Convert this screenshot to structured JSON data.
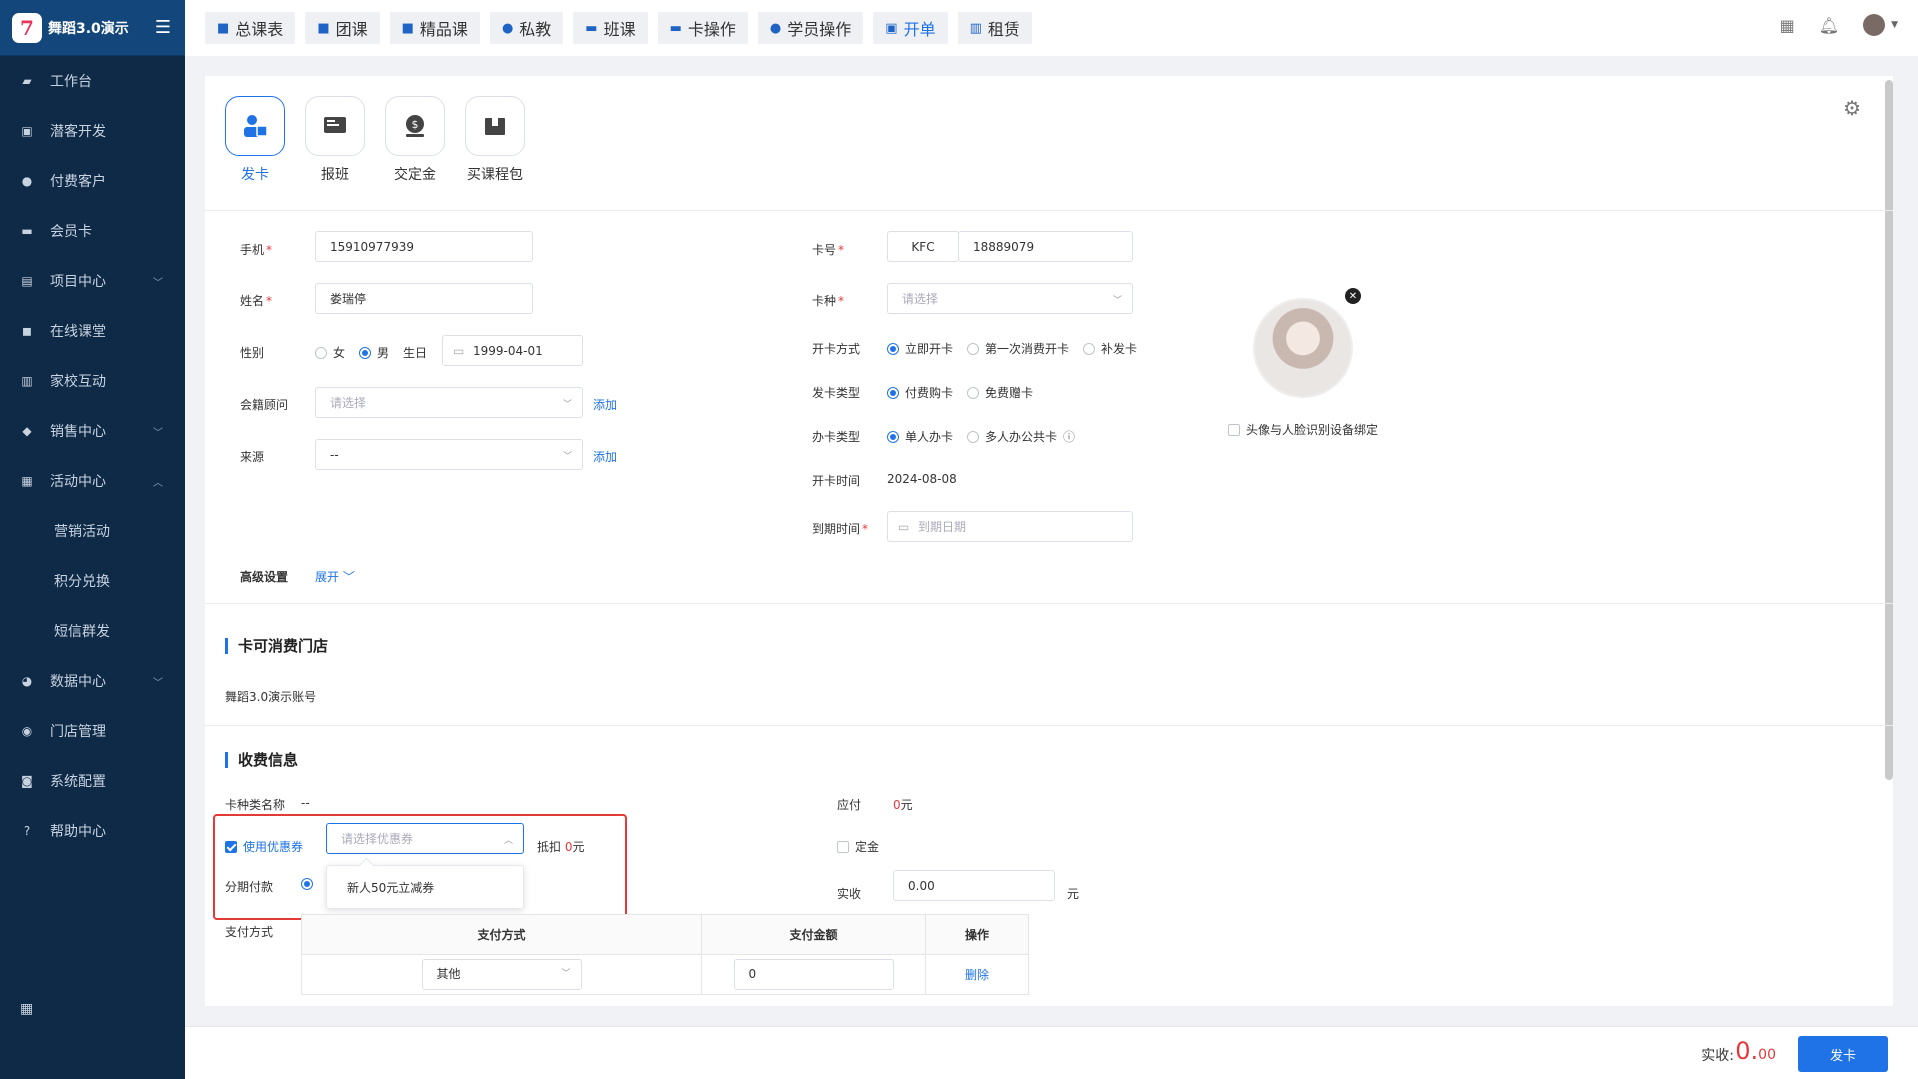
{
  "app": {
    "title": "舞蹈3.0演示",
    "logo_char": "7"
  },
  "sidebar": {
    "items": [
      {
        "label": "工作台",
        "icon": "dashboard-icon"
      },
      {
        "label": "潜客开发",
        "icon": "prospect-icon"
      },
      {
        "label": "付费客户",
        "icon": "customers-icon"
      },
      {
        "label": "会员卡",
        "icon": "card-icon"
      },
      {
        "label": "项目中心",
        "icon": "project-icon",
        "chevron": "down"
      },
      {
        "label": "在线课堂",
        "icon": "classroom-icon"
      },
      {
        "label": "家校互动",
        "icon": "interaction-icon"
      },
      {
        "label": "销售中心",
        "icon": "sales-icon",
        "chevron": "down"
      },
      {
        "label": "活动中心",
        "icon": "activity-icon",
        "chevron": "up"
      },
      {
        "label": "营销活动",
        "sub": true
      },
      {
        "label": "积分兑换",
        "sub": true
      },
      {
        "label": "短信群发",
        "sub": true
      },
      {
        "label": "数据中心",
        "icon": "data-icon",
        "chevron": "down"
      },
      {
        "label": "门店管理",
        "icon": "store-icon"
      },
      {
        "label": "系统配置",
        "icon": "settings-icon"
      },
      {
        "label": "帮助中心",
        "icon": "help-icon"
      }
    ]
  },
  "topbar": {
    "buttons": [
      "总课表",
      "团课",
      "精品课",
      "私教",
      "班课",
      "卡操作",
      "学员操作",
      "开单",
      "租赁"
    ],
    "active": "开单"
  },
  "tabs": [
    {
      "label": "发卡",
      "active": true
    },
    {
      "label": "报班"
    },
    {
      "label": "交定金"
    },
    {
      "label": "买课程包"
    }
  ],
  "form": {
    "phone_label": "手机",
    "phone_value": "15910977939",
    "name_label": "姓名",
    "name_value": "娄瑞停",
    "gender_label": "性别",
    "gender_female": "女",
    "gender_male": "男",
    "birthday_label": "生日",
    "birthday_value": "1999-04-01",
    "advisor_label": "会籍顾问",
    "advisor_placeholder": "请选择",
    "add": "添加",
    "source_label": "来源",
    "source_value": "--",
    "advanced_label": "高级设置",
    "expand": "展开",
    "cardno_label": "卡号",
    "cardno_prefix": "KFC",
    "cardno_value": "18889079",
    "cardtype_label": "卡种",
    "cardtype_placeholder": "请选择",
    "open_label": "开卡方式",
    "open_opts": [
      "立即开卡",
      "第一次消费开卡",
      "补发卡"
    ],
    "issue_label": "发卡类型",
    "issue_opts": [
      "付费购卡",
      "免费赠卡"
    ],
    "handle_label": "办卡类型",
    "handle_opts": [
      "单人办卡",
      "多人办公共卡"
    ],
    "opentime_label": "开卡时间",
    "opentime_value": "2024-08-08",
    "expire_label": "到期时间",
    "expire_placeholder": "到期日期",
    "face_bind": "头像与人脸识别设备绑定"
  },
  "stores": {
    "title": "卡可消费门店",
    "value": "舞蹈3.0演示账号"
  },
  "fees": {
    "title": "收费信息",
    "cardname_label": "卡种类名称",
    "cardname_value": "--",
    "coupon_label": "使用优惠券",
    "coupon_placeholder": "请选择优惠券",
    "deduct_label": "抵扣",
    "deduct_value": "0",
    "yuan": "元",
    "installment_label": "分期付款",
    "coupon_option": "新人50元立减券",
    "payable_label": "应付",
    "payable_value": "0",
    "deposit_label": "定金",
    "actual_label": "实收",
    "actual_value": "0.00",
    "paymethod_label": "支付方式",
    "table_headers": [
      "支付方式",
      "支付金额",
      "操作"
    ],
    "row_method": "其他",
    "row_amount": "0",
    "row_action": "删除"
  },
  "footer": {
    "label": "实收:",
    "amount_int": "0.",
    "amount_dec": "00",
    "submit": "发卡"
  },
  "colors": {
    "accent": "#1f73e6",
    "sidebar": "#0f2a47",
    "alert": "#e4393c"
  }
}
